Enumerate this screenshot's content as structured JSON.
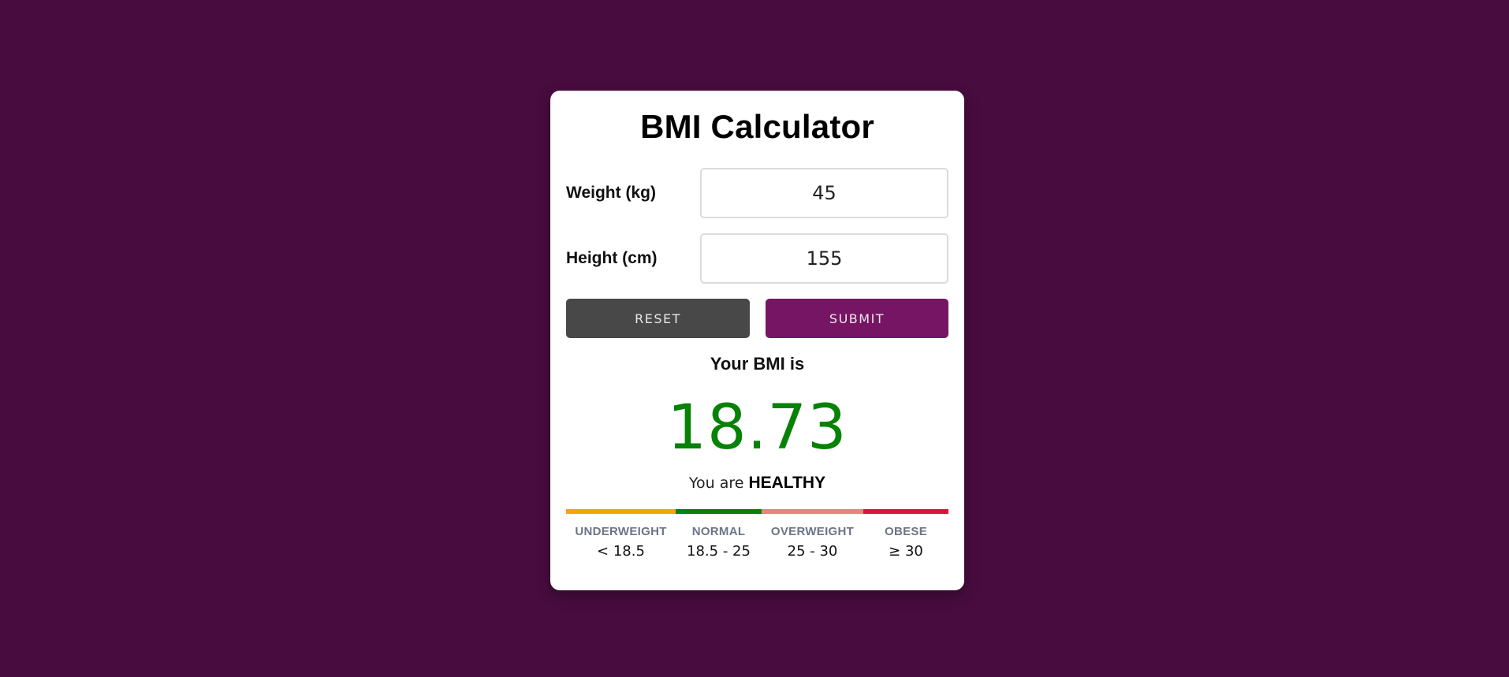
{
  "app": {
    "title": "BMI Calculator"
  },
  "form": {
    "weight_label": "Weight (kg)",
    "weight_value": "45",
    "height_label": "Height (cm)",
    "height_value": "155"
  },
  "buttons": {
    "reset_label": "RESET",
    "submit_label": "SUBMIT"
  },
  "result": {
    "label": "Your BMI is",
    "value": "18.73",
    "status_prefix": "You are",
    "status_value": "HEALTHY"
  },
  "scale": {
    "categories": [
      {
        "name": "UNDERWEIGHT",
        "range": "< 18.5",
        "color": "#f5a700"
      },
      {
        "name": "NORMAL",
        "range": "18.5 - 25",
        "color": "#078206"
      },
      {
        "name": "OVERWEIGHT",
        "range": "25 - 30",
        "color": "#f08080"
      },
      {
        "name": "OBESE",
        "range": "≥ 30",
        "color": "#dc143c"
      }
    ]
  },
  "colors": {
    "background": "#480c3f",
    "card": "#ffffff",
    "reset_button": "#484848",
    "submit_button": "#761563",
    "bmi_value": "#078206",
    "category_label": "#6c7487"
  }
}
